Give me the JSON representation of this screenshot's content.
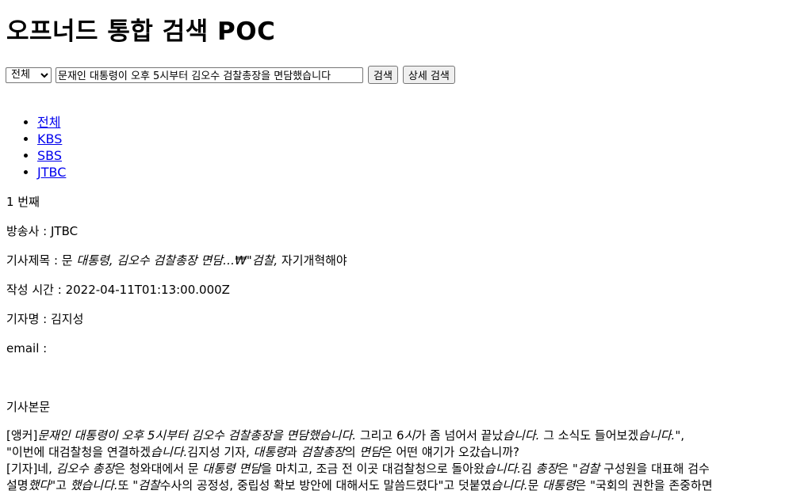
{
  "page": {
    "title": "오프너드 통합 검색 POC"
  },
  "search": {
    "scope_selected": "전체",
    "query": "문재인 대통령이 오후 5시부터 김오수 검찰총장을 면담했습니다",
    "search_button": "검색",
    "advanced_button": "상세 검색"
  },
  "tabs": [
    {
      "label": "전체"
    },
    {
      "label": "KBS"
    },
    {
      "label": "SBS"
    },
    {
      "label": "JTBC"
    }
  ],
  "result": {
    "index_text": "1 번째",
    "broadcaster_label": "방송사 : ",
    "broadcaster": "JTBC",
    "title_label": "기사제목 : ",
    "title_plain1": "문 ",
    "title_em1": "대통령, 김오수 검찰총장 면담…₩\"검찰,",
    "title_plain2": " 자기개혁해야",
    "time_label": "작성 시간 : ",
    "time": "2022-04-11T01:13:00.000Z",
    "reporter_label": "기자명 : ",
    "reporter": "김지성",
    "email_label": "email : ",
    "email": "",
    "body_label": "기사본문",
    "body": {
      "l1_a": "[앵커]",
      "l1_b": "문재인 대통령이 오후 5시부터 김오수 검찰총장을 면담했습니다.",
      "l1_c": " 그리고 6",
      "l1_d": "시",
      "l1_e": "가 좀 넘어서 끝났",
      "l1_f": "습니다.",
      "l1_g": " 그 소식도 들어보겠",
      "l1_h": "습니다.",
      "l1_i": "\",",
      "l2_a": "\"이번에 대검찰청을 연결하겠",
      "l2_b": "습니다.",
      "l2_c": "김지성 기자, ",
      "l2_d": "대통령",
      "l2_e": "과 ",
      "l2_f": "검찰총장",
      "l2_g": "의 ",
      "l2_h": "면담",
      "l2_i": "은 어떤 얘기가 오갔습니까?",
      "l3_a": "[기자]네, ",
      "l3_b": "김오수 총장",
      "l3_c": "은 청와대에서 문 ",
      "l3_d": "대통령 면담",
      "l3_e": "을 마치고, 조금 전 이곳 대검찰청으로 돌아왔",
      "l3_f": "습니다.",
      "l3_g": "김 ",
      "l3_h": "총장",
      "l3_i": "은 \"",
      "l3_j": "검찰",
      "l3_k": " 구성원을 대표해 검수",
      "l4_a": "설명",
      "l4_b": "했다",
      "l4_c": "\"고 ",
      "l4_d": "했습니다.",
      "l4_e": "또 \"",
      "l4_f": "검찰",
      "l4_g": "수사의 공정성, 중립성 확보 방안에 대해서도 말씀드렸다\"고 덧붙였",
      "l4_h": "습니다.",
      "l4_i": "문 ",
      "l4_j": "대통령",
      "l4_k": "은 \"국회의 권한을 존중하면"
    }
  }
}
